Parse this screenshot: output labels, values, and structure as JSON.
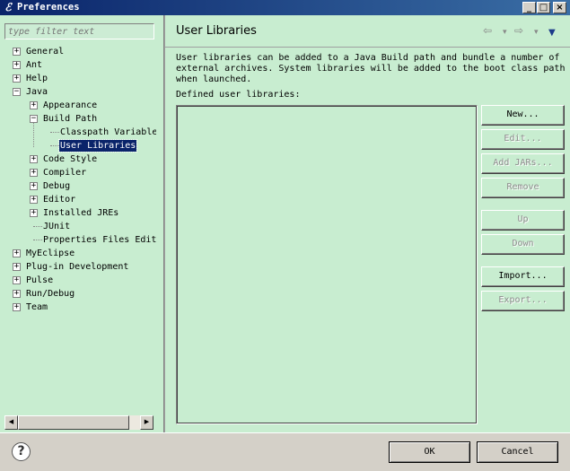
{
  "window": {
    "title": "Preferences",
    "app_icon": "eclipse-icon",
    "minimize": "_",
    "maximize": "□",
    "close": "×"
  },
  "filter": {
    "placeholder": "type filter text"
  },
  "tree": {
    "items": [
      {
        "label": "General",
        "level": 0,
        "expander": "+"
      },
      {
        "label": "Ant",
        "level": 0,
        "expander": "+"
      },
      {
        "label": "Help",
        "level": 0,
        "expander": "+"
      },
      {
        "label": "Java",
        "level": 0,
        "expander": "−"
      },
      {
        "label": "Appearance",
        "level": 1,
        "expander": "+"
      },
      {
        "label": "Build Path",
        "level": 1,
        "expander": "−"
      },
      {
        "label": "Classpath Variable",
        "level": 2,
        "expander": ""
      },
      {
        "label": "User Libraries",
        "level": 2,
        "expander": "",
        "selected": true
      },
      {
        "label": "Code Style",
        "level": 1,
        "expander": "+"
      },
      {
        "label": "Compiler",
        "level": 1,
        "expander": "+"
      },
      {
        "label": "Debug",
        "level": 1,
        "expander": "+"
      },
      {
        "label": "Editor",
        "level": 1,
        "expander": "+"
      },
      {
        "label": "Installed JREs",
        "level": 1,
        "expander": "+"
      },
      {
        "label": "JUnit",
        "level": 1,
        "expander": ""
      },
      {
        "label": "Properties Files Edit",
        "level": 1,
        "expander": ""
      },
      {
        "label": "MyEclipse",
        "level": 0,
        "expander": "+"
      },
      {
        "label": "Plug-in Development",
        "level": 0,
        "expander": "+"
      },
      {
        "label": "Pulse",
        "level": 0,
        "expander": "+"
      },
      {
        "label": "Run/Debug",
        "level": 0,
        "expander": "+"
      },
      {
        "label": "Team",
        "level": 0,
        "expander": "+"
      }
    ]
  },
  "scrollbar": {
    "left_arrow": "◀",
    "right_arrow": "▶"
  },
  "page": {
    "title": "User Libraries",
    "nav_back": "⇦",
    "nav_back_menu": "▾",
    "nav_forward": "⇨",
    "nav_forward_menu": "▾",
    "view_menu": "▼",
    "description_lines": [
      "User libraries can be added to a Java Build path and bundle a number of",
      "external archives. System libraries will be added to the boot class path",
      "when launched."
    ],
    "defined_label": "Defined user libraries:",
    "buttons": [
      {
        "label": "New...",
        "enabled": true
      },
      {
        "label": "Edit...",
        "enabled": false
      },
      {
        "label": "Add JARs...",
        "enabled": false
      },
      {
        "label": "Remove",
        "enabled": false
      },
      {
        "label": "Up",
        "enabled": false
      },
      {
        "label": "Down",
        "enabled": false
      },
      {
        "label": "Import...",
        "enabled": true
      },
      {
        "label": "Export...",
        "enabled": false
      }
    ]
  },
  "footer": {
    "help_icon": "?",
    "ok_label": "OK",
    "cancel_label": "Cancel"
  },
  "colors": {
    "pane_background": "#c8edd0",
    "selection": "#0a246a",
    "titlebar": "#0a246a"
  }
}
